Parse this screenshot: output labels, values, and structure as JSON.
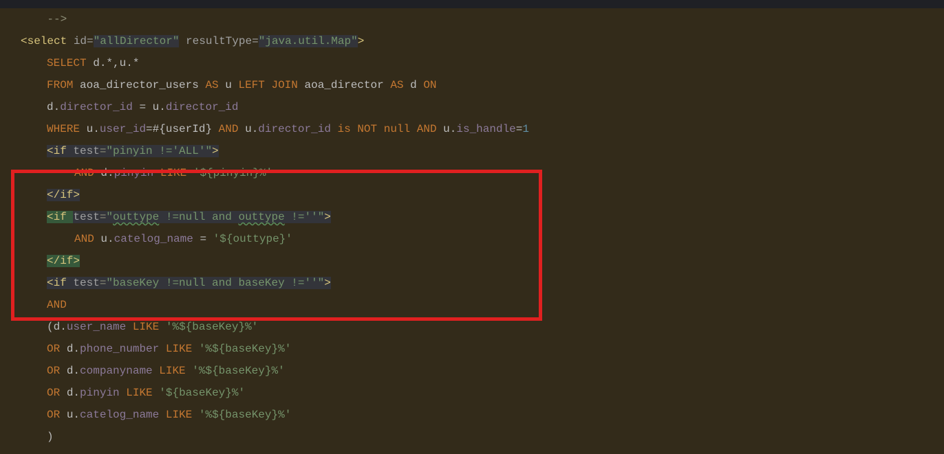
{
  "tabStrip": "",
  "lines": {
    "l0": {
      "a": "    --&gt;"
    },
    "l1": {
      "a": "&lt;select ",
      "b": "id",
      "c": "=",
      "d": "\"allDirector\"",
      "e": " resultType",
      "f": "=",
      "g": "\"java.util.Map\"",
      "h": "&gt;"
    },
    "l2": {
      "a": "SELECT ",
      "b": "d",
      "c": ".*,",
      "d": "u",
      "e": ".*"
    },
    "l3": {
      "a": "FROM ",
      "b": "aoa_director_users ",
      "c": "AS ",
      "d": "u ",
      "e": "LEFT JOIN ",
      "f": "aoa_director ",
      "g": "AS ",
      "h": "d ",
      "i": "ON"
    },
    "l4": {
      "a": "d",
      "b": ".",
      "c": "director_id ",
      "d": "= ",
      "e": "u",
      "f": ".",
      "g": "director_id"
    },
    "l5": {
      "a": "WHERE ",
      "b": "u",
      "c": ".",
      "d": "user_id",
      "e": "=#{userId} ",
      "f": "AND ",
      "g": "u",
      "h": ".",
      "i": "director_id ",
      "j": "is NOT null AND ",
      "k": "u",
      "l": ".",
      "m": "is_handle",
      "n": "=",
      "o": "1"
    },
    "l6": {
      "a": "&lt;if ",
      "b": "test",
      "c": "=",
      "d": "\"pinyin !='ALL'\"",
      "e": "&gt;"
    },
    "l7": {
      "a": "AND ",
      "b": "d",
      "c": ".",
      "d": "pinyin ",
      "e": "LIKE ",
      "f": "'${pinyin}%'"
    },
    "l8": {
      "a": "&lt;/if&gt;"
    },
    "l9": {
      "a": "&lt;if ",
      "b": "test",
      "c": "=",
      "d": "\"",
      "e": "outtype",
      "f": " !=null and ",
      "g": "outtype",
      "h": " !=''\"",
      "i": "&gt;"
    },
    "l10": {
      "a": "AND ",
      "b": "u",
      "c": ".",
      "d": "catelog_name ",
      "e": "= ",
      "f": "'${outtype}'"
    },
    "l11": {
      "a": "&lt;/if&gt;"
    },
    "l12": {
      "a": "&lt;if ",
      "b": "test",
      "c": "=",
      "d": "\"baseKey !=null and baseKey !=''\"",
      "e": "&gt;"
    },
    "l13": {
      "a": "AND"
    },
    "l14": {
      "a": "(",
      "b": "d",
      "c": ".",
      "d": "user_name ",
      "e": "LIKE ",
      "f": "'%${baseKey}%'"
    },
    "l15": {
      "a": "OR ",
      "b": "d",
      "c": ".",
      "d": "phone_number ",
      "e": "LIKE ",
      "f": "'%${baseKey}%'"
    },
    "l16": {
      "a": "OR ",
      "b": "d",
      "c": ".",
      "d": "companyname ",
      "e": "LIKE ",
      "f": "'%${baseKey}%'"
    },
    "l17": {
      "a": "OR ",
      "b": "d",
      "c": ".",
      "d": "pinyin ",
      "e": "LIKE ",
      "f": "'${baseKey}%'"
    },
    "l18": {
      "a": "OR ",
      "b": "u",
      "c": ".",
      "d": "catelog_name ",
      "e": "LIKE ",
      "f": "'%${baseKey}%'"
    },
    "l19": {
      "a": ")"
    }
  }
}
